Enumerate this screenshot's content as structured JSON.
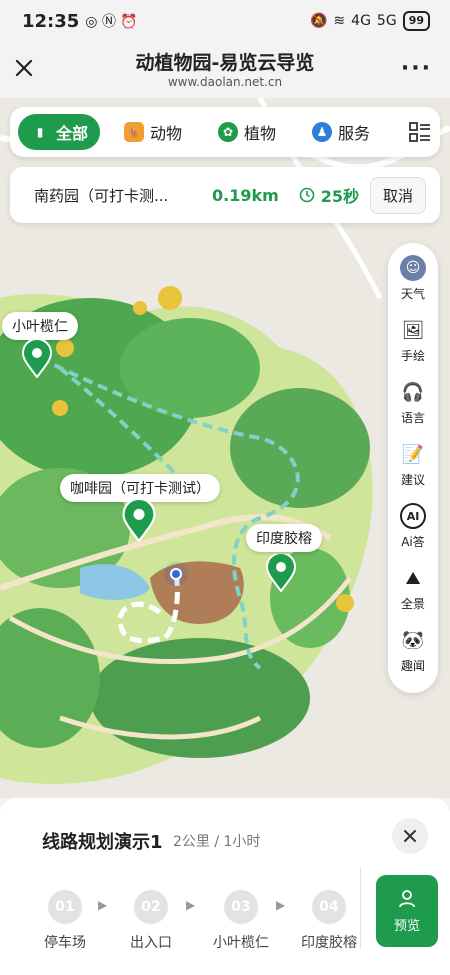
{
  "statusbar": {
    "time": "12:35",
    "battery": "99",
    "net1": "4G",
    "net2": "5G"
  },
  "header": {
    "title": "动植物园-易览云导览",
    "url": "www.daolan.net.cn"
  },
  "categories": [
    {
      "label": "全部",
      "icon": "book-icon",
      "active": true
    },
    {
      "label": "动物",
      "icon": "deer-icon",
      "active": false
    },
    {
      "label": "植物",
      "icon": "sprout-icon",
      "active": false
    },
    {
      "label": "服务",
      "icon": "service-icon",
      "active": false
    }
  ],
  "route_card": {
    "destination": "南药园（可打卡测...",
    "distance": "0.19km",
    "duration": "25秒",
    "cancel_label": "取消"
  },
  "right_tools": [
    {
      "label": "天气",
      "icon": "smile-icon"
    },
    {
      "label": "手绘",
      "icon": "image-icon"
    },
    {
      "label": "语言",
      "icon": "headphones-icon"
    },
    {
      "label": "建议",
      "icon": "note-edit-icon"
    },
    {
      "label": "Ai答",
      "icon": "ai-icon"
    },
    {
      "label": "全景",
      "icon": "panorama-icon"
    },
    {
      "label": "趣闻",
      "icon": "panda-icon"
    }
  ],
  "map_labels": {
    "xiaoye": "小叶榄仁",
    "coffee": "咖啡园（可打卡测试）",
    "yindu": "印度胶榕"
  },
  "route_panel": {
    "title": "线路规划演示1",
    "meta": "2公里 / 1小时",
    "steps": [
      {
        "num": "01",
        "name": "停车场"
      },
      {
        "num": "02",
        "name": "出入口"
      },
      {
        "num": "03",
        "name": "小叶榄仁"
      },
      {
        "num": "04",
        "name": "印度胶榕"
      }
    ],
    "preview_label": "预览"
  }
}
